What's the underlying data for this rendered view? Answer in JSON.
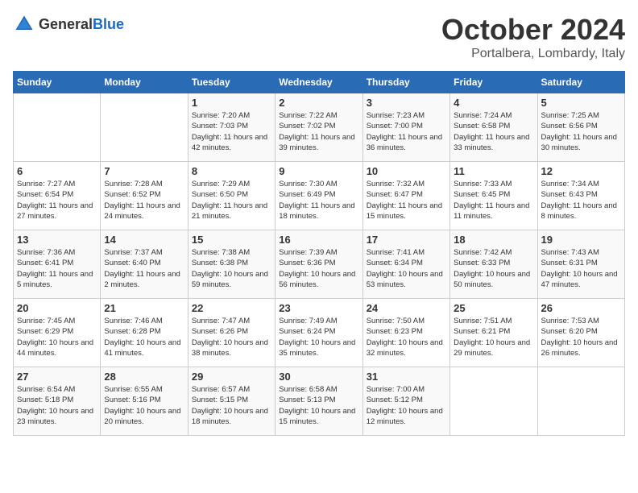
{
  "logo": {
    "general": "General",
    "blue": "Blue"
  },
  "header": {
    "title": "October 2024",
    "subtitle": "Portalbera, Lombardy, Italy"
  },
  "weekdays": [
    "Sunday",
    "Monday",
    "Tuesday",
    "Wednesday",
    "Thursday",
    "Friday",
    "Saturday"
  ],
  "weeks": [
    [
      {
        "day": "",
        "info": ""
      },
      {
        "day": "",
        "info": ""
      },
      {
        "day": "1",
        "sunrise": "Sunrise: 7:20 AM",
        "sunset": "Sunset: 7:03 PM",
        "daylight": "Daylight: 11 hours and 42 minutes."
      },
      {
        "day": "2",
        "sunrise": "Sunrise: 7:22 AM",
        "sunset": "Sunset: 7:02 PM",
        "daylight": "Daylight: 11 hours and 39 minutes."
      },
      {
        "day": "3",
        "sunrise": "Sunrise: 7:23 AM",
        "sunset": "Sunset: 7:00 PM",
        "daylight": "Daylight: 11 hours and 36 minutes."
      },
      {
        "day": "4",
        "sunrise": "Sunrise: 7:24 AM",
        "sunset": "Sunset: 6:58 PM",
        "daylight": "Daylight: 11 hours and 33 minutes."
      },
      {
        "day": "5",
        "sunrise": "Sunrise: 7:25 AM",
        "sunset": "Sunset: 6:56 PM",
        "daylight": "Daylight: 11 hours and 30 minutes."
      }
    ],
    [
      {
        "day": "6",
        "sunrise": "Sunrise: 7:27 AM",
        "sunset": "Sunset: 6:54 PM",
        "daylight": "Daylight: 11 hours and 27 minutes."
      },
      {
        "day": "7",
        "sunrise": "Sunrise: 7:28 AM",
        "sunset": "Sunset: 6:52 PM",
        "daylight": "Daylight: 11 hours and 24 minutes."
      },
      {
        "day": "8",
        "sunrise": "Sunrise: 7:29 AM",
        "sunset": "Sunset: 6:50 PM",
        "daylight": "Daylight: 11 hours and 21 minutes."
      },
      {
        "day": "9",
        "sunrise": "Sunrise: 7:30 AM",
        "sunset": "Sunset: 6:49 PM",
        "daylight": "Daylight: 11 hours and 18 minutes."
      },
      {
        "day": "10",
        "sunrise": "Sunrise: 7:32 AM",
        "sunset": "Sunset: 6:47 PM",
        "daylight": "Daylight: 11 hours and 15 minutes."
      },
      {
        "day": "11",
        "sunrise": "Sunrise: 7:33 AM",
        "sunset": "Sunset: 6:45 PM",
        "daylight": "Daylight: 11 hours and 11 minutes."
      },
      {
        "day": "12",
        "sunrise": "Sunrise: 7:34 AM",
        "sunset": "Sunset: 6:43 PM",
        "daylight": "Daylight: 11 hours and 8 minutes."
      }
    ],
    [
      {
        "day": "13",
        "sunrise": "Sunrise: 7:36 AM",
        "sunset": "Sunset: 6:41 PM",
        "daylight": "Daylight: 11 hours and 5 minutes."
      },
      {
        "day": "14",
        "sunrise": "Sunrise: 7:37 AM",
        "sunset": "Sunset: 6:40 PM",
        "daylight": "Daylight: 11 hours and 2 minutes."
      },
      {
        "day": "15",
        "sunrise": "Sunrise: 7:38 AM",
        "sunset": "Sunset: 6:38 PM",
        "daylight": "Daylight: 10 hours and 59 minutes."
      },
      {
        "day": "16",
        "sunrise": "Sunrise: 7:39 AM",
        "sunset": "Sunset: 6:36 PM",
        "daylight": "Daylight: 10 hours and 56 minutes."
      },
      {
        "day": "17",
        "sunrise": "Sunrise: 7:41 AM",
        "sunset": "Sunset: 6:34 PM",
        "daylight": "Daylight: 10 hours and 53 minutes."
      },
      {
        "day": "18",
        "sunrise": "Sunrise: 7:42 AM",
        "sunset": "Sunset: 6:33 PM",
        "daylight": "Daylight: 10 hours and 50 minutes."
      },
      {
        "day": "19",
        "sunrise": "Sunrise: 7:43 AM",
        "sunset": "Sunset: 6:31 PM",
        "daylight": "Daylight: 10 hours and 47 minutes."
      }
    ],
    [
      {
        "day": "20",
        "sunrise": "Sunrise: 7:45 AM",
        "sunset": "Sunset: 6:29 PM",
        "daylight": "Daylight: 10 hours and 44 minutes."
      },
      {
        "day": "21",
        "sunrise": "Sunrise: 7:46 AM",
        "sunset": "Sunset: 6:28 PM",
        "daylight": "Daylight: 10 hours and 41 minutes."
      },
      {
        "day": "22",
        "sunrise": "Sunrise: 7:47 AM",
        "sunset": "Sunset: 6:26 PM",
        "daylight": "Daylight: 10 hours and 38 minutes."
      },
      {
        "day": "23",
        "sunrise": "Sunrise: 7:49 AM",
        "sunset": "Sunset: 6:24 PM",
        "daylight": "Daylight: 10 hours and 35 minutes."
      },
      {
        "day": "24",
        "sunrise": "Sunrise: 7:50 AM",
        "sunset": "Sunset: 6:23 PM",
        "daylight": "Daylight: 10 hours and 32 minutes."
      },
      {
        "day": "25",
        "sunrise": "Sunrise: 7:51 AM",
        "sunset": "Sunset: 6:21 PM",
        "daylight": "Daylight: 10 hours and 29 minutes."
      },
      {
        "day": "26",
        "sunrise": "Sunrise: 7:53 AM",
        "sunset": "Sunset: 6:20 PM",
        "daylight": "Daylight: 10 hours and 26 minutes."
      }
    ],
    [
      {
        "day": "27",
        "sunrise": "Sunrise: 6:54 AM",
        "sunset": "Sunset: 5:18 PM",
        "daylight": "Daylight: 10 hours and 23 minutes."
      },
      {
        "day": "28",
        "sunrise": "Sunrise: 6:55 AM",
        "sunset": "Sunset: 5:16 PM",
        "daylight": "Daylight: 10 hours and 20 minutes."
      },
      {
        "day": "29",
        "sunrise": "Sunrise: 6:57 AM",
        "sunset": "Sunset: 5:15 PM",
        "daylight": "Daylight: 10 hours and 18 minutes."
      },
      {
        "day": "30",
        "sunrise": "Sunrise: 6:58 AM",
        "sunset": "Sunset: 5:13 PM",
        "daylight": "Daylight: 10 hours and 15 minutes."
      },
      {
        "day": "31",
        "sunrise": "Sunrise: 7:00 AM",
        "sunset": "Sunset: 5:12 PM",
        "daylight": "Daylight: 10 hours and 12 minutes."
      },
      {
        "day": "",
        "info": ""
      },
      {
        "day": "",
        "info": ""
      }
    ]
  ]
}
